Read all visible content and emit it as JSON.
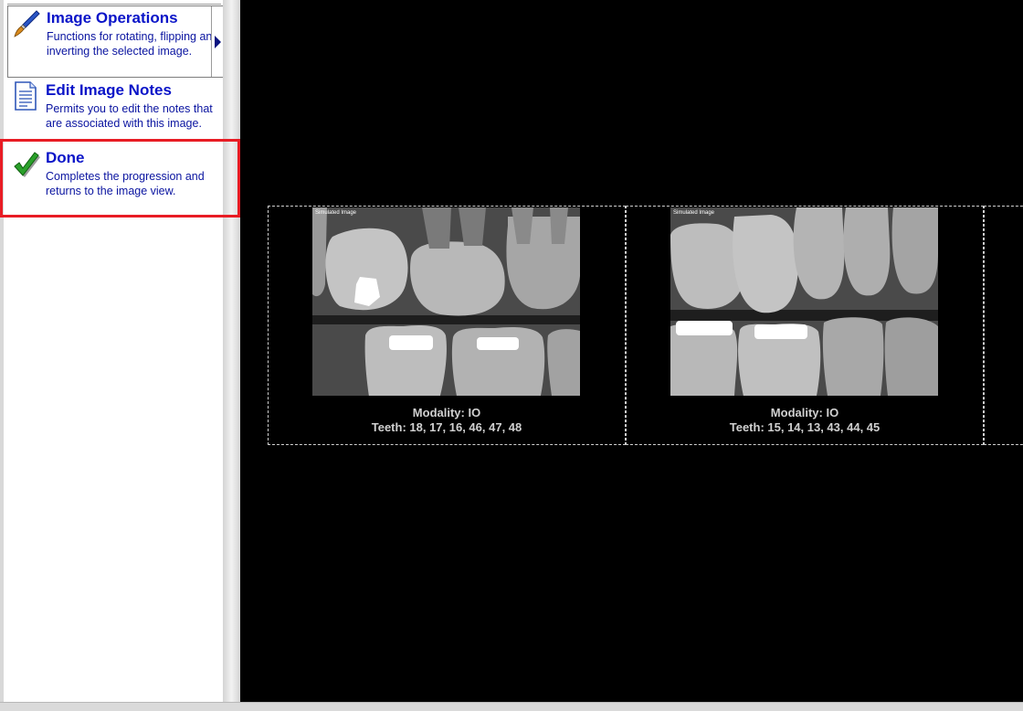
{
  "tasks": [
    {
      "title": "Image Operations",
      "description": "Functions for rotating, flipping and inverting the selected image.",
      "icon": "paintbrush-icon"
    },
    {
      "title": "Edit Image Notes",
      "description": "Permits you to edit the notes that are associated with this image.",
      "icon": "document-icon"
    },
    {
      "title": "Done",
      "description": "Completes the progression and returns to the image view.",
      "icon": "checkmark-icon"
    }
  ],
  "images": [
    {
      "overlay": "Simulated Image",
      "modality": "Modality: IO",
      "teeth": "Teeth: 18, 17, 16, 46, 47, 48"
    },
    {
      "overlay": "Simulated Image",
      "modality": "Modality: IO",
      "teeth": "Teeth: 15, 14, 13, 43, 44, 45"
    }
  ],
  "colors": {
    "task_title": "#0a14c8",
    "highlight": "#e81c24",
    "viewer_background": "#000000"
  }
}
